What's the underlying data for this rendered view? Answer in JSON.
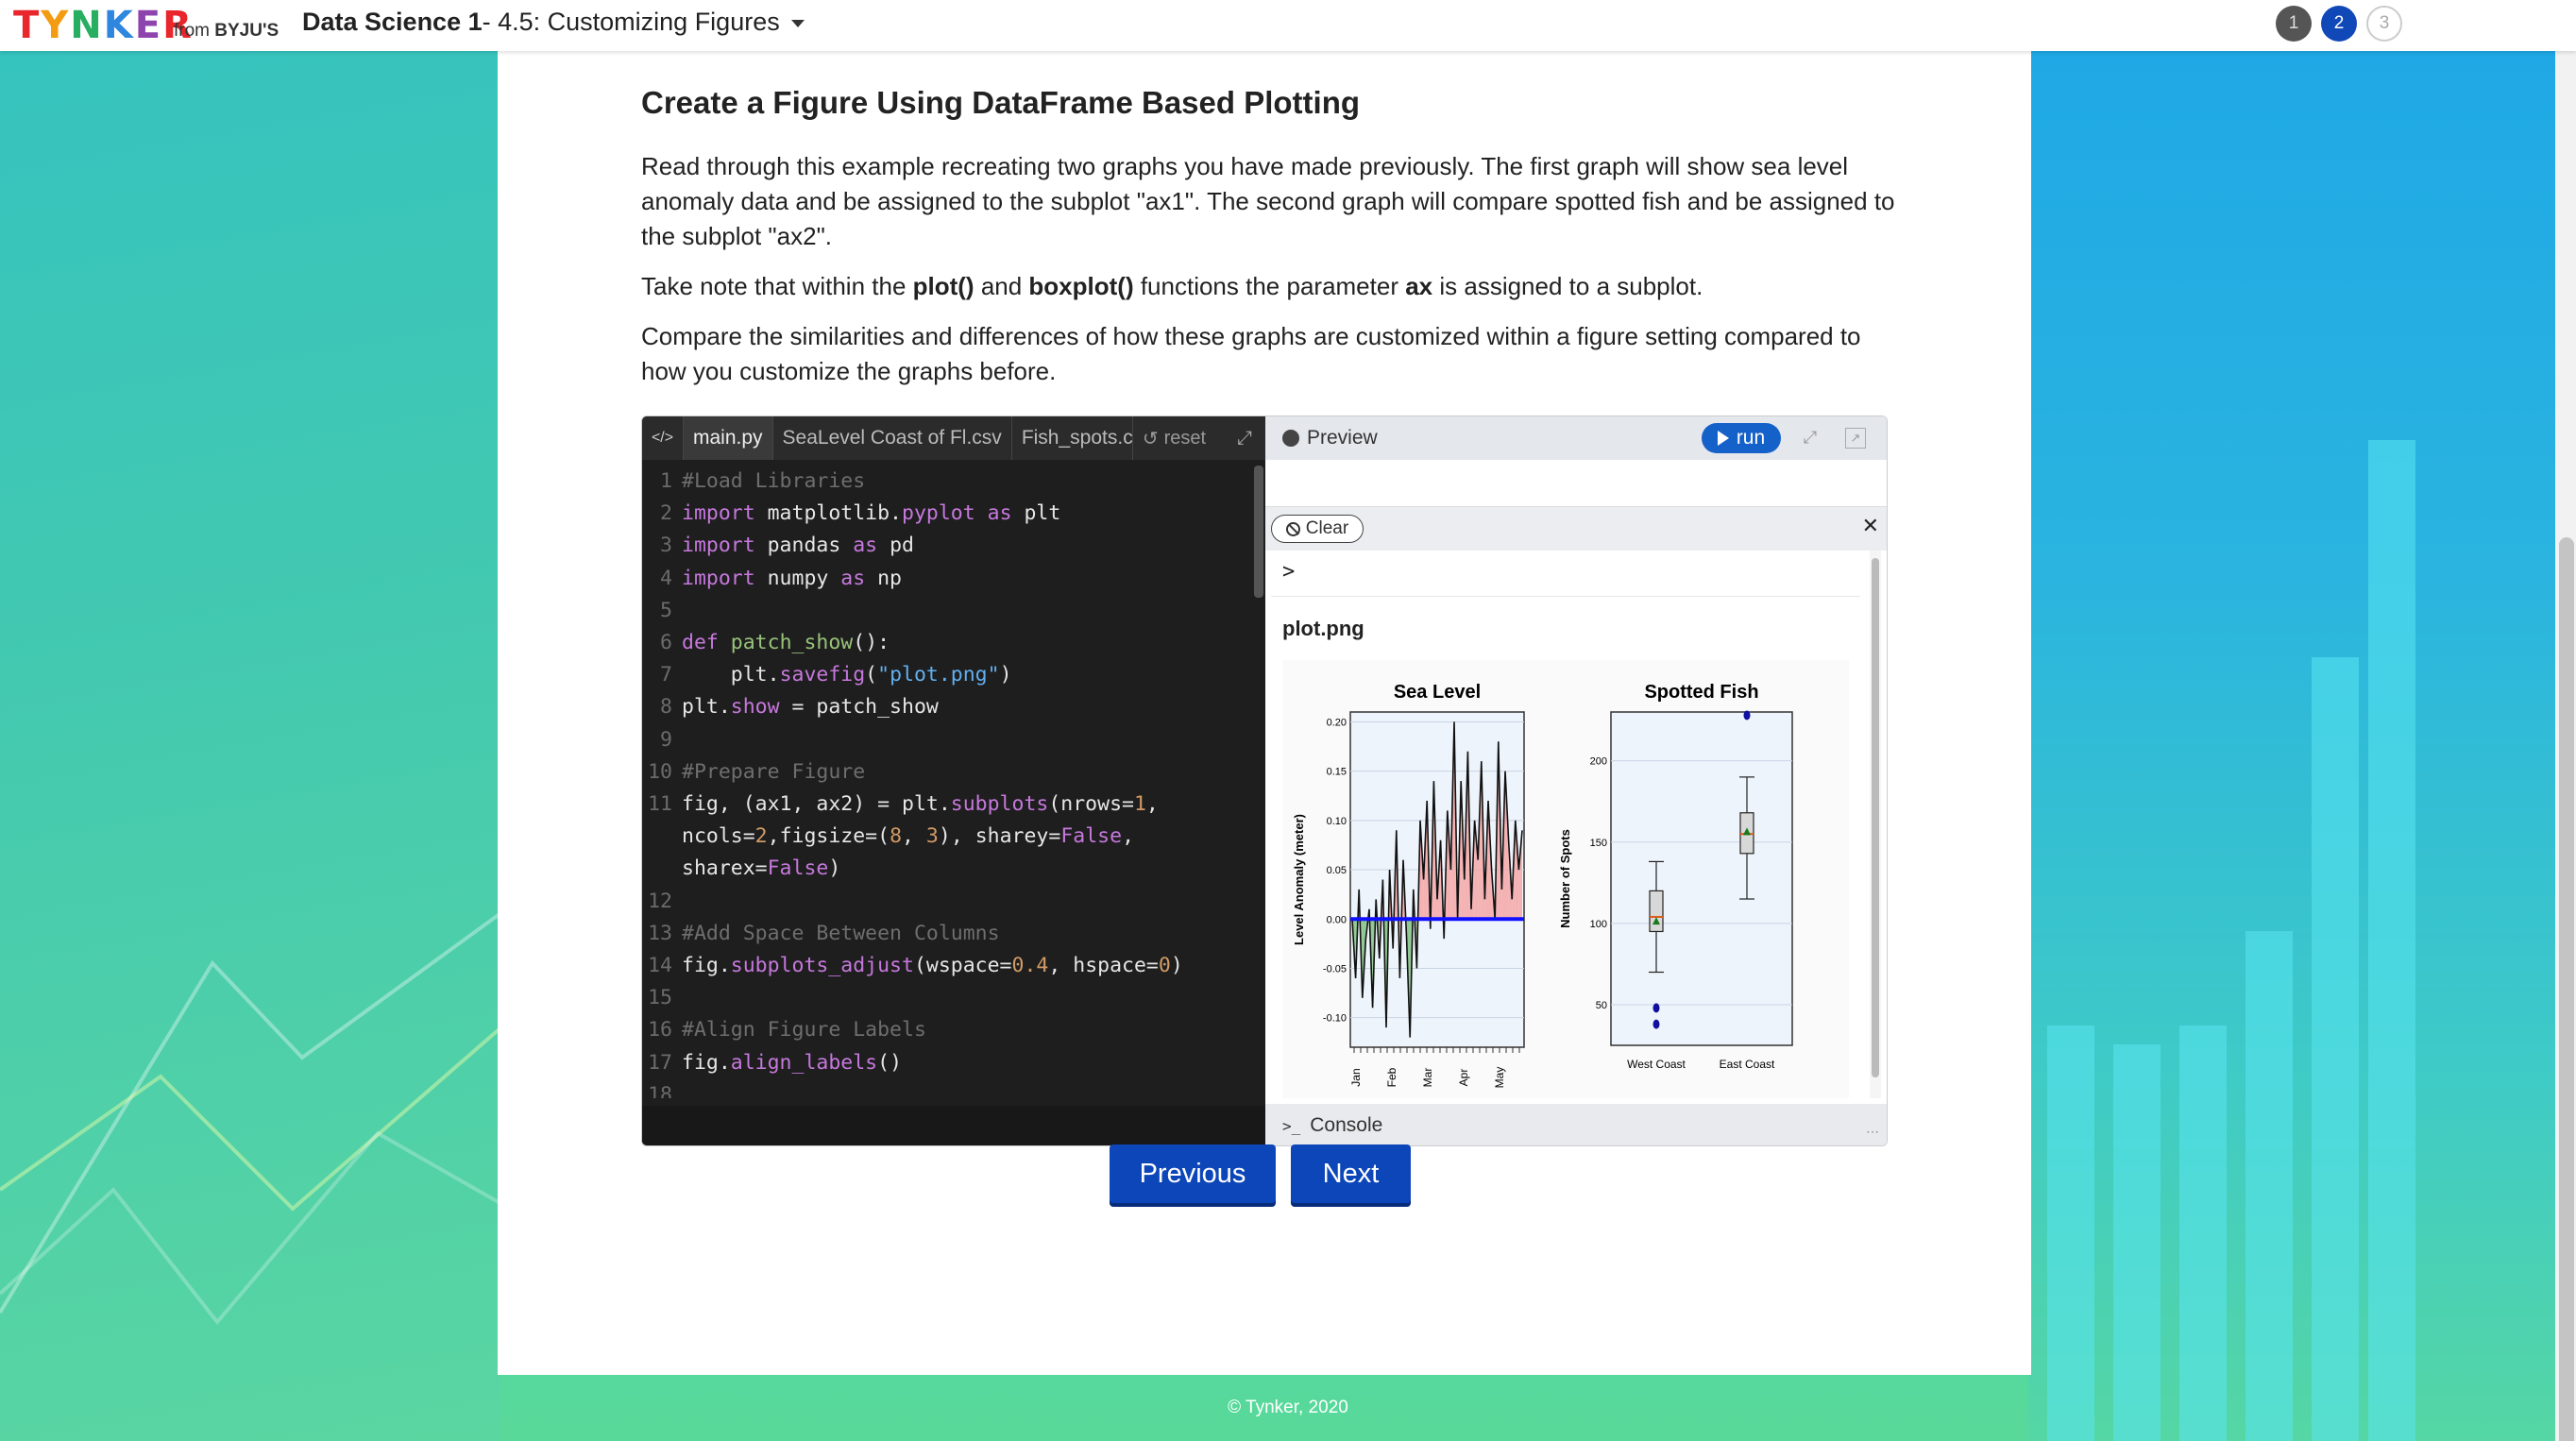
{
  "header": {
    "logo_text": "TYNKER",
    "logo_from": "from",
    "logo_brand": "BYJU'S",
    "course_name": "Data Science 1",
    "lesson_title": " - 4.5: Customizing Figures",
    "steps": [
      "1",
      "2",
      "3"
    ],
    "active_step": "2"
  },
  "content": {
    "cut_text": "... ... ...",
    "title": "Create a Figure Using DataFrame Based Plotting",
    "para1": "Read through this example recreating two graphs you have made previously. The first graph will show sea level anomaly data and be assigned to the subplot \"ax1\". The second graph will compare spotted fish and be assigned to the subplot \"ax2\".",
    "para2_a": "Take note that within the ",
    "para2_b": "plot()",
    "para2_c": " and ",
    "para2_d": "boxplot()",
    "para2_e": " functions the parameter ",
    "para2_f": "ax",
    "para2_g": " is assigned to a subplot.",
    "para3": "Compare the similarities and differences of how these graphs are customized within a figure setting compared to how you customize the graphs before."
  },
  "editor": {
    "code_icon": "</>",
    "tabs": [
      "main.py",
      "SeaLevel Coast of Fl.csv",
      "Fish_spots.csv"
    ],
    "reset_label": "reset",
    "line_numbers": [
      "1",
      "2",
      "3",
      "4",
      "5",
      "6",
      "7",
      "8",
      "9",
      "10",
      "11",
      "",
      "",
      "12",
      "13",
      "14",
      "15",
      "16",
      "17",
      "18"
    ]
  },
  "preview": {
    "title": "Preview",
    "run_label": "run",
    "clear_label": "Clear",
    "prompt": ">",
    "output_file": "plot.png",
    "console_label": "Console"
  },
  "chart_data": [
    {
      "type": "line",
      "title": "Sea Level",
      "xlabel": "",
      "ylabel": "Level Anomaly (meter)",
      "yticks": [
        "0.20",
        "0.15",
        "0.10",
        "0.05",
        "0.00",
        "-0.05",
        "-0.10"
      ],
      "xticks": [
        "Jan",
        "Feb",
        "Mar",
        "Apr",
        "May"
      ],
      "ylim": [
        -0.13,
        0.21
      ],
      "reference_line": 0.0,
      "values": [
        0.0,
        -0.06,
        0.03,
        -0.08,
        -0.02,
        0.01,
        -0.09,
        0.02,
        -0.04,
        0.04,
        -0.11,
        0.05,
        -0.03,
        0.09,
        -0.06,
        0.06,
        -0.02,
        -0.12,
        0.03,
        -0.05,
        0.1,
        0.04,
        0.12,
        -0.01,
        0.14,
        0.02,
        0.08,
        -0.02,
        0.11,
        0.05,
        0.2,
        0.0,
        0.14,
        0.04,
        0.17,
        0.01,
        0.1,
        0.06,
        0.16,
        0.02,
        0.12,
        0.05,
        0.0,
        0.18,
        0.03,
        0.15,
        0.08,
        0.02,
        0.1,
        0.05,
        0.09
      ]
    },
    {
      "type": "box",
      "title": "Spotted Fish",
      "ylabel": "Number of Spots",
      "yticks": [
        "200",
        "150",
        "100",
        "50"
      ],
      "ylim": [
        25,
        230
      ],
      "categories": [
        "West Coast",
        "East Coast"
      ],
      "boxes": [
        {
          "name": "West Coast",
          "whisker_low": 70,
          "q1": 95,
          "median": 104,
          "q3": 120,
          "whisker_high": 138,
          "mean": 101,
          "outliers": [
            48,
            38
          ]
        },
        {
          "name": "East Coast",
          "whisker_low": 115,
          "q1": 143,
          "median": 155,
          "q3": 168,
          "whisker_high": 190,
          "mean": 156,
          "outliers": [
            228
          ]
        }
      ]
    }
  ],
  "footer": {
    "copyright": "© Tynker, 2020"
  },
  "nav": {
    "previous": "Previous",
    "next": "Next"
  },
  "colors": {
    "primary_button": "#0d46b8",
    "run_button": "#1461c9",
    "editor_bg": "#1e1e1e",
    "fill_positive": "#f4a6a6",
    "fill_negative": "#7fbf7f",
    "zero_line": "#1010ff",
    "box_points": "#1010a0"
  }
}
